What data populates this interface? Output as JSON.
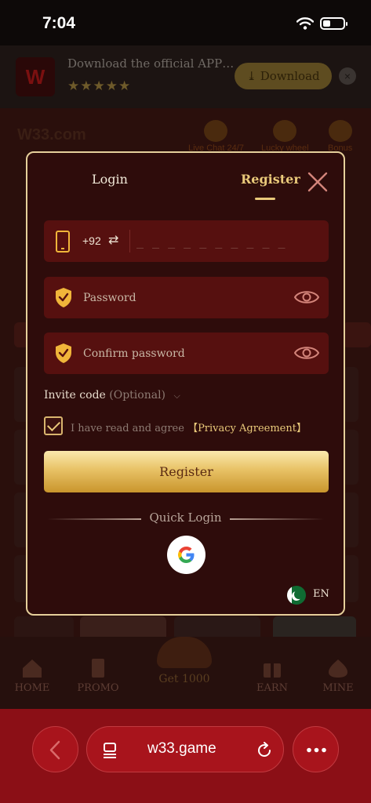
{
  "status_bar": {
    "time": "7:04"
  },
  "app_banner": {
    "logo_text": "W",
    "text": "Download the official APP…",
    "stars": "★★★★★",
    "download_label": "Download",
    "close_label": "×"
  },
  "site_header": {
    "logo": "W33.com",
    "live_chat": "Live Chat 24/7",
    "lucky_wheel": "Lucky wheel",
    "bonus": "Bonus"
  },
  "modal": {
    "tabs": [
      {
        "label": "Login",
        "active": false
      },
      {
        "label": "Register",
        "active": true
      }
    ],
    "phone": {
      "country_code": "+92",
      "swap_icon": "⇄",
      "placeholder": "_ _ _ _ _ _ _ _ _ _"
    },
    "password": {
      "placeholder": "Password"
    },
    "confirm_password": {
      "placeholder": "Confirm password"
    },
    "invite": {
      "label": "Invite code",
      "optional": "(Optional)"
    },
    "agreement": {
      "checked": true,
      "text": "I have read and agree ",
      "link": "【Privacy Agreement】"
    },
    "register_button": "Register",
    "quick_login_label": "Quick Login",
    "language": "EN"
  },
  "bottom_nav": {
    "items": [
      {
        "label": "HOME"
      },
      {
        "label": "PROMO"
      },
      {
        "label": "Get 1000"
      },
      {
        "label": "EARN"
      },
      {
        "label": "MINE"
      }
    ]
  },
  "browser": {
    "url": "w33.game"
  },
  "colors": {
    "accent_gold": "#e9c97a",
    "modal_bg": "#2e0c0b",
    "field_bg": "#56100f",
    "browser_bar": "#8b0f16"
  },
  "icons": [
    "wifi-icon",
    "battery-icon",
    "phone-icon",
    "swap-icon",
    "shield-icon",
    "eye-icon",
    "close-icon",
    "chevron-down-icon",
    "check-icon",
    "google-icon",
    "flag-icon",
    "back-icon",
    "tabs-icon",
    "reload-icon",
    "more-icon"
  ]
}
